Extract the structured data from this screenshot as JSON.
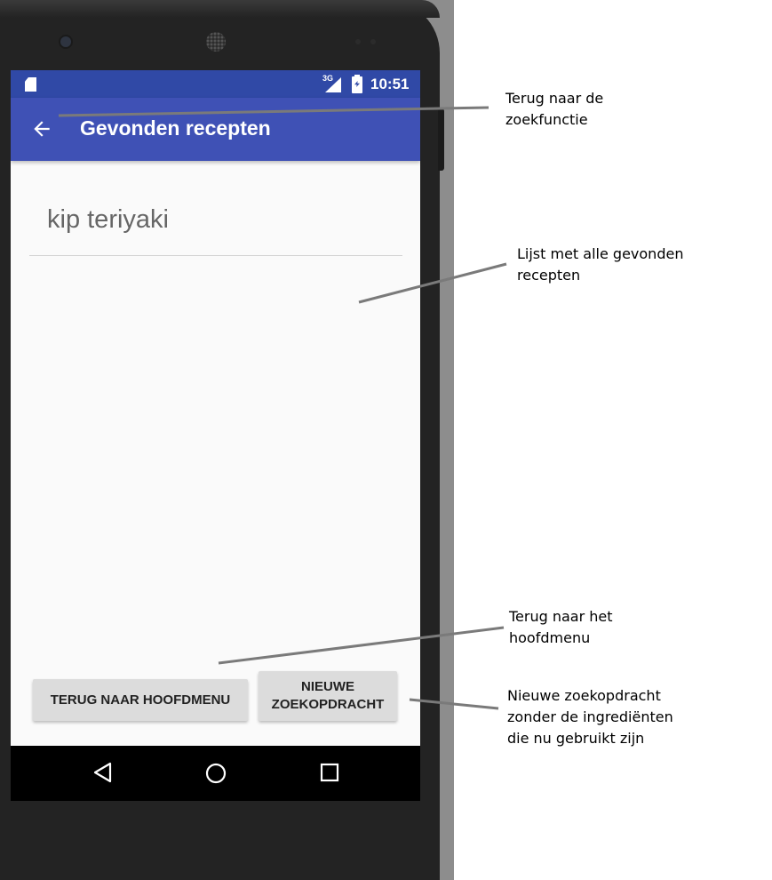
{
  "status_bar": {
    "network": "3G",
    "time": "10:51"
  },
  "app_bar": {
    "title": "Gevonden recepten",
    "back_icon": "arrow-back-icon"
  },
  "search": {
    "query": "kip teriyaki"
  },
  "recipe_list": {
    "items": []
  },
  "buttons": {
    "home": "TERUG NAAR HOOFDMENU",
    "new_search_line1": "NIEUWE",
    "new_search_line2": "ZOEKOPDRACHT"
  },
  "nav_bar": {
    "icons": [
      "nav-back-icon",
      "nav-home-icon",
      "nav-recent-icon"
    ]
  },
  "annotations": {
    "back": "Terug naar de\nzoekfunctie",
    "list": "Lijst met alle gevonden\nrecepten",
    "home": "Terug naar het\nhoofdmenu",
    "new_search": "Nieuwe zoekopdracht\nzonder de ingrediënten\ndie nu gebruikt zijn"
  },
  "colors": {
    "status_bar": "#3049a6",
    "app_bar": "#3f51b5",
    "button": "#dcdcdc",
    "callout_line": "#7a7a7a"
  }
}
